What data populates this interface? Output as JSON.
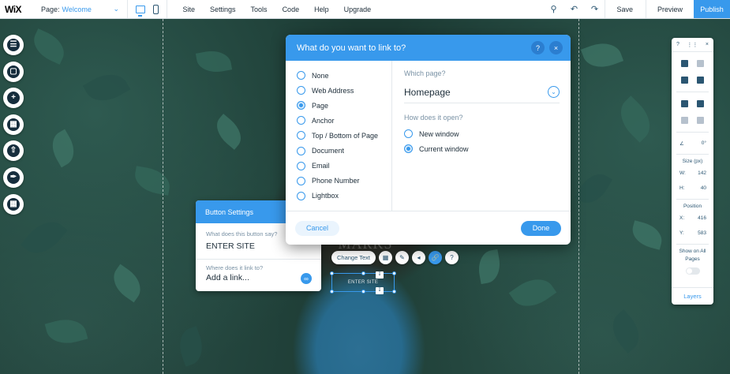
{
  "topbar": {
    "logo": "WiX",
    "page_label": "Page:",
    "page_value": "Welcome",
    "menu": [
      "Site",
      "Settings",
      "Tools",
      "Code",
      "Help",
      "Upgrade"
    ],
    "save": "Save",
    "preview": "Preview",
    "publish": "Publish"
  },
  "left_bar": {
    "items": [
      "pages-icon",
      "background-icon",
      "add-icon",
      "app-market-icon",
      "upload-icon",
      "blog-icon",
      "store-icon"
    ]
  },
  "right_panel": {
    "help": "?",
    "close": "×",
    "angle": "0°",
    "size_label": "Size (px)",
    "w_label": "W:",
    "w_value": "142",
    "h_label": "H:",
    "h_value": "40",
    "position_label": "Position",
    "x_label": "X:",
    "x_value": "416",
    "y_label": "Y:",
    "y_value": "583",
    "show_all_label": "Show on All Pages",
    "layers": "Layers"
  },
  "dialog": {
    "title": "What do you want to link to?",
    "help": "?",
    "close": "×",
    "options": [
      "None",
      "Web Address",
      "Page",
      "Anchor",
      "Top / Bottom of Page",
      "Document",
      "Email",
      "Phone Number",
      "Lightbox"
    ],
    "selected_option": "Page",
    "which_page_label": "Which page?",
    "which_page_value": "Homepage",
    "open_label": "How does it open?",
    "open_options": [
      "New window",
      "Current window"
    ],
    "open_selected": "Current window",
    "cancel": "Cancel",
    "done": "Done"
  },
  "button_settings": {
    "title": "Button Settings",
    "text_question": "What does this button say?",
    "text_value": "ENTER SITE",
    "link_question": "Where does it link to?",
    "link_value": "Add a link..."
  },
  "float_bar": {
    "change_text": "Change Text"
  },
  "canvas": {
    "button_text": "ENTER SITE",
    "site_title_fragment": "MARKS"
  },
  "colors": {
    "accent": "#3899ec",
    "text_dark": "#20303c",
    "muted": "#7a92a5"
  }
}
